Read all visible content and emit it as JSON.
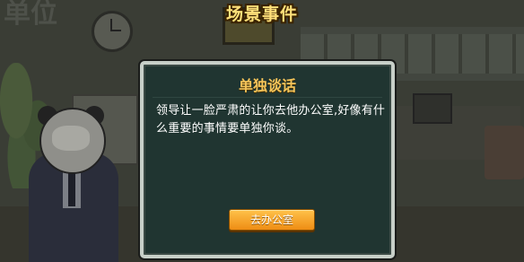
{
  "header": {
    "title": "场景事件"
  },
  "dialog": {
    "title": "单独谈话",
    "body": "领导让一脸严肃的让你去他办公室,好像有什么重要的事情要单独你谈。",
    "action_label": "去办公室"
  },
  "background": {
    "faded_sign": "单位",
    "colors": {
      "title_text": "#ffe07a",
      "dialog_bg": "#203531",
      "dialog_title": "#f4c45a",
      "button": "#ee8d14"
    }
  }
}
